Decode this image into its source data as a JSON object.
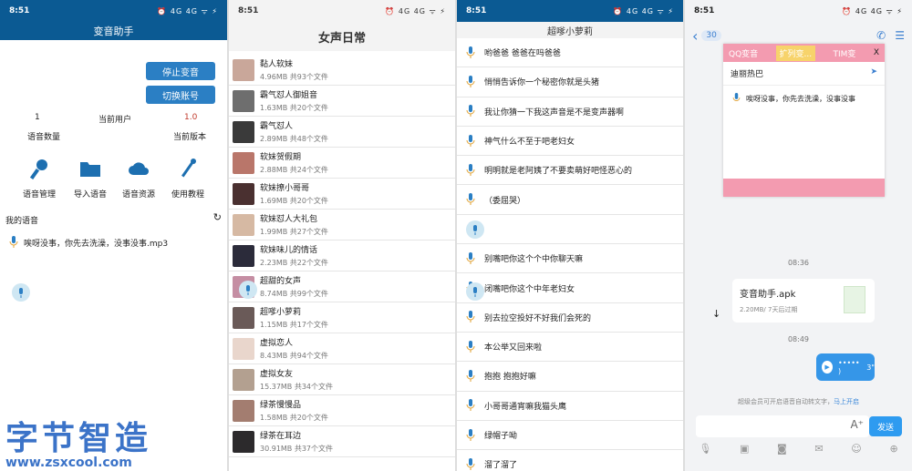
{
  "status": {
    "time": "8:51",
    "icons": "⏰ 4G 4G ᯤ ⚡"
  },
  "screen1": {
    "title": "变音助手",
    "btn_stop": "停止变音",
    "btn_switch": "切换账号",
    "voice_count": "1",
    "voice_count_label": "语音数量",
    "current_user_label": "当前用户",
    "version": "1.0",
    "version_label": "当前版本",
    "tools": [
      "语音管理",
      "导入语音",
      "语音资源",
      "使用教程"
    ],
    "my_voice": "我的语音",
    "voice_item": "唉呀没事，你先去洗澡，没事没事.mp3"
  },
  "screen2": {
    "title": "女声日常",
    "items": [
      {
        "name": "黏人软妹",
        "meta": "4.96MB  共93个文件"
      },
      {
        "name": "霸气怼人御姐音",
        "meta": "1.63MB  共20个文件"
      },
      {
        "name": "霸气怼人",
        "meta": "2.89MB  共48个文件"
      },
      {
        "name": "软妹贺假期",
        "meta": "2.88MB  共24个文件"
      },
      {
        "name": "软妹撩小哥哥",
        "meta": "1.69MB  共20个文件"
      },
      {
        "name": "软妹怼人大礼包",
        "meta": "1.99MB  共27个文件"
      },
      {
        "name": "软妹味儿的情话",
        "meta": "2.23MB  共22个文件"
      },
      {
        "name": "超甜的女声",
        "meta": "8.74MB  共99个文件"
      },
      {
        "name": "超嗲小萝莉",
        "meta": "1.15MB  共17个文件"
      },
      {
        "name": "虚拟恋人",
        "meta": "8.43MB  共94个文件"
      },
      {
        "name": "虚拟女友",
        "meta": "15.37MB  共34个文件"
      },
      {
        "name": "绿茶慢慢品",
        "meta": "1.58MB  共20个文件"
      },
      {
        "name": "绿茶在耳边",
        "meta": "30.91MB  共37个文件"
      }
    ],
    "avatar_colors": [
      "#c9a79a",
      "#6e6e6e",
      "#3a3a3a",
      "#b9766a",
      "#4a3030",
      "#d6b9a3",
      "#2b2b3a",
      "#c58ea3",
      "#6a5a58",
      "#e9d6cc",
      "#b3a090",
      "#a37d70",
      "#2c2a2c"
    ]
  },
  "screen3": {
    "title": "超嗲小萝莉",
    "rows": [
      "哟爸爸 爸爸在吗爸爸",
      "悄悄告诉你一个秘密你就是头猪",
      "我让你猜一下我这声音是不是变声器啊",
      "神气什么不至于吧老妇女",
      "明明就是老阿姨了不要卖萌好吧怪恶心的",
      "（委屈哭）",
      "",
      "别嘴吧你这个个中你聊天嘛",
      "闭嘴吧你这个中年老妇女",
      "别去拉空投好不好我们会死的",
      "本公举又回来啦",
      "抱抱 抱抱好嘛",
      "小哥哥通宵嘛我猫头鹰",
      "绿帽子呦",
      "溜了溜了"
    ]
  },
  "screen4": {
    "unread": "30",
    "popup_tabs": [
      "QQ变音",
      "扩列变...",
      "TIM变",
      "X"
    ],
    "popup_hot": "迪丽热巴",
    "popup_item": "唉呀没事，你先去洗澡，没事没事",
    "time1": "08:36",
    "file_name": "变音助手.apk",
    "file_size": "2.20MB/ 7天后过期",
    "time2": "08:49",
    "voice_len": "3\"",
    "vip_text": "超级会员可开启语音自动转文字，",
    "vip_link": "马上开启",
    "send": "发送"
  },
  "watermark": {
    "line1": "字节智造",
    "line2": "www.zsxcool.com"
  }
}
